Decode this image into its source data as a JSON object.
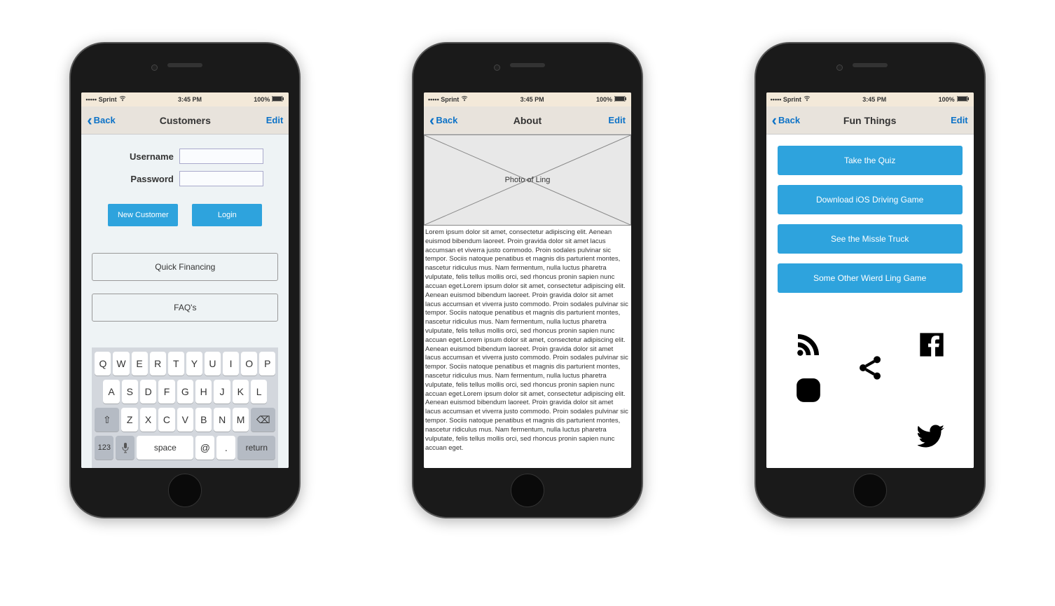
{
  "status": {
    "carrier": "••••• Sprint",
    "time": "3:45 PM",
    "battery": "100%"
  },
  "nav": {
    "back": "Back",
    "edit": "Edit"
  },
  "screen1": {
    "title": "Customers",
    "username_label": "Username",
    "password_label": "Password",
    "new_customer": "New Customer",
    "login": "Login",
    "quick_financing": "Quick Financing",
    "faqs": "FAQ's",
    "keyboard": {
      "r1": [
        "Q",
        "W",
        "E",
        "R",
        "T",
        "Y",
        "U",
        "I",
        "O",
        "P"
      ],
      "r2": [
        "A",
        "S",
        "D",
        "F",
        "G",
        "H",
        "J",
        "K",
        "L"
      ],
      "r3": [
        "⇧",
        "Z",
        "X",
        "C",
        "V",
        "B",
        "N",
        "M",
        "⌫"
      ],
      "r4_123": "123",
      "r4_mic": "🎤",
      "r4_space": "space",
      "r4_at": "@",
      "r4_dot": ".",
      "r4_return": "return"
    }
  },
  "screen2": {
    "title": "About",
    "photo_caption": "Photo of Ling",
    "body": "Lorem ipsum dolor sit amet, consectetur adipiscing elit. Aenean euismod bibendum laoreet. Proin gravida dolor sit amet lacus accumsan et viverra justo commodo. Proin sodales pulvinar sic tempor. Sociis natoque penatibus et magnis dis parturient montes, nascetur ridiculus mus. Nam fermentum, nulla luctus pharetra vulputate, felis tellus mollis orci, sed rhoncus pronin sapien nunc accuan eget.Lorem ipsum dolor sit amet, consectetur adipiscing elit. Aenean euismod bibendum laoreet. Proin gravida dolor sit amet lacus accumsan et viverra justo commodo. Proin sodales pulvinar sic tempor. Sociis natoque penatibus et magnis dis parturient montes, nascetur ridiculus mus. Nam fermentum, nulla luctus pharetra vulputate, felis tellus mollis orci, sed rhoncus pronin sapien nunc accuan eget.Lorem ipsum dolor sit amet, consectetur adipiscing elit. Aenean euismod bibendum laoreet. Proin gravida dolor sit amet lacus accumsan et viverra justo commodo. Proin sodales pulvinar sic tempor. Sociis natoque penatibus et magnis dis parturient montes, nascetur ridiculus mus. Nam fermentum, nulla luctus pharetra vulputate, felis tellus mollis orci, sed rhoncus pronin sapien nunc accuan eget.Lorem ipsum dolor sit amet, consectetur adipiscing elit. Aenean euismod bibendum laoreet. Proin gravida dolor sit amet lacus accumsan et viverra justo commodo. Proin sodales pulvinar sic tempor. Sociis natoque penatibus et magnis dis parturient montes, nascetur ridiculus mus. Nam fermentum, nulla luctus pharetra vulputate, felis tellus mollis orci, sed rhoncus pronin sapien nunc accuan eget."
  },
  "screen3": {
    "title": "Fun Things",
    "btn1": "Take the Quiz",
    "btn2": "Download iOS Driving Game",
    "btn3": "See the Missle Truck",
    "btn4": "Some Other Wierd Ling Game",
    "icons": {
      "rss": "rss-icon",
      "facebook": "facebook-icon",
      "share": "share-icon",
      "instagram": "instagram-icon",
      "twitter": "twitter-icon"
    }
  }
}
